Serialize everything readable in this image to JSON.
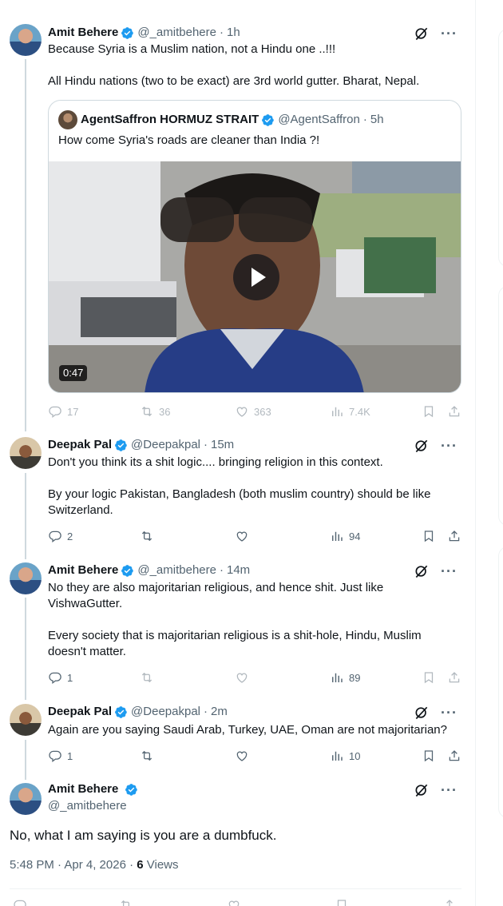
{
  "tweets": [
    {
      "name": "Amit Behere",
      "handle": "@_amitbehere",
      "time": "1h",
      "text": "Because Syria is a Muslim nation, not a Hindu one ..!!!\n\nAll Hindu nations (two to be exact) are 3rd world gutter. Bharat, Nepal.",
      "quote": {
        "name": "AgentSaffron HORMUZ STRAIT",
        "handle": "@AgentSaffron",
        "time": "5h",
        "text": "How come Syria's roads are cleaner than India ?!",
        "video_duration": "0:47"
      },
      "replies": "17",
      "reposts": "36",
      "likes": "363",
      "views": "7.4K"
    },
    {
      "name": "Deepak Pal",
      "handle": "@Deepakpal",
      "time": "15m",
      "text": "Don't you think its a shit logic.... bringing religion in this context.\n\nBy your logic Pakistan, Bangladesh (both muslim country) should be like Switzerland.",
      "replies": "2",
      "reposts": "",
      "likes": "",
      "views": "94"
    },
    {
      "name": "Amit Behere",
      "handle": "@_amitbehere",
      "time": "14m",
      "text": "No they are also majoritarian religious, and hence shit. Just like VishwaGutter.\n\nEvery society that is majoritarian religious is a shit-hole, Hindu, Muslim doesn't matter.",
      "replies": "1",
      "reposts": "",
      "likes": "",
      "views": "89"
    },
    {
      "name": "Deepak Pal",
      "handle": "@Deepakpal",
      "time": "2m",
      "text": "Again are you  saying Saudi Arab, Turkey, UAE, Oman are not majoritarian?",
      "replies": "1",
      "reposts": "",
      "likes": "",
      "views": "10"
    }
  ],
  "main_tweet": {
    "name": "Amit Behere",
    "handle": "@_amitbehere",
    "text": "No, what I am saying is you are a dumbfuck.",
    "timestamp": "5:48 PM · Apr 4, 2026 · ",
    "views_count": "6",
    "views_label": " Views"
  },
  "colors": {
    "verified": "#1d9bf0",
    "text": "#0f1419",
    "secondary": "#536471",
    "border": "#cfd9de"
  },
  "icons": [
    "reply-icon",
    "repost-icon",
    "like-icon",
    "views-icon",
    "bookmark-icon",
    "share-icon",
    "grok-icon",
    "more-icon",
    "verified-badge-icon",
    "play-icon"
  ]
}
